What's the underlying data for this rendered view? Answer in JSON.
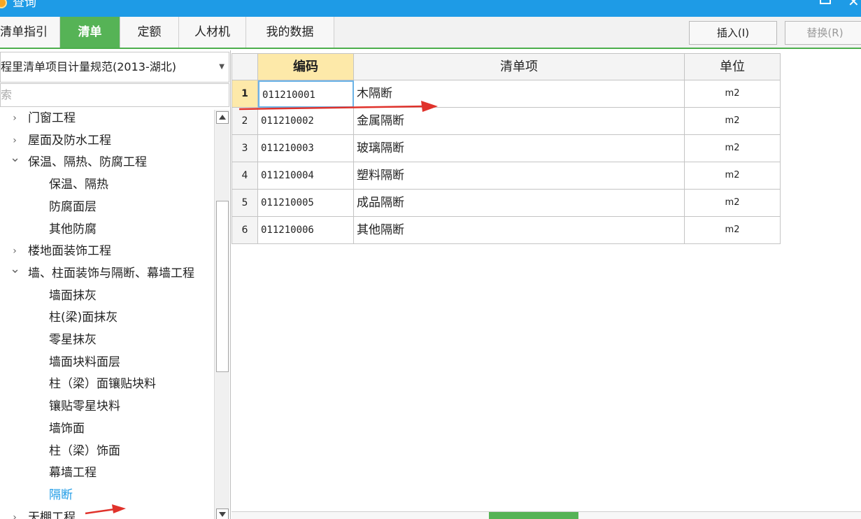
{
  "window": {
    "title": "查询",
    "icons": [
      "app-icon",
      "maximize-icon",
      "close-icon"
    ]
  },
  "tabs": [
    {
      "label": "清单指引",
      "active": false
    },
    {
      "label": "清单",
      "active": true
    },
    {
      "label": "定额",
      "active": false
    },
    {
      "label": "人材机",
      "active": false
    },
    {
      "label": "我的数据",
      "active": false
    }
  ],
  "toolbar": {
    "insert_label": "插入(I)",
    "replace_label": "替换(R)"
  },
  "left": {
    "spec_selected": "程里清单项目计量规范(2013-湖北)",
    "search_placeholder": "索",
    "tree": [
      {
        "label": "门窗工程",
        "level": 0,
        "expanded": false
      },
      {
        "label": "屋面及防水工程",
        "level": 0,
        "expanded": false
      },
      {
        "label": "保温、隔热、防腐工程",
        "level": 0,
        "expanded": true
      },
      {
        "label": "保温、隔热",
        "level": 1
      },
      {
        "label": "防腐面层",
        "level": 1
      },
      {
        "label": "其他防腐",
        "level": 1
      },
      {
        "label": "楼地面装饰工程",
        "level": 0,
        "expanded": false
      },
      {
        "label": "墙、柱面装饰与隔断、幕墙工程",
        "level": 0,
        "expanded": true
      },
      {
        "label": "墙面抹灰",
        "level": 1
      },
      {
        "label": "柱(梁)面抹灰",
        "level": 1
      },
      {
        "label": "零星抹灰",
        "level": 1
      },
      {
        "label": "墙面块料面层",
        "level": 1
      },
      {
        "label": "柱（梁）面镶贴块料",
        "level": 1
      },
      {
        "label": "镶贴零星块料",
        "level": 1
      },
      {
        "label": "墙饰面",
        "level": 1
      },
      {
        "label": "柱（梁）饰面",
        "level": 1
      },
      {
        "label": "幕墙工程",
        "level": 1
      },
      {
        "label": "隔断",
        "level": 1,
        "selected": true
      },
      {
        "label": "天棚工程",
        "level": 0,
        "expanded": false
      }
    ]
  },
  "grid": {
    "headers": {
      "code": "编码",
      "name": "清单项",
      "unit": "单位"
    },
    "rows": [
      {
        "num": "1",
        "code": "011210001",
        "name": "木隔断",
        "unit": "m2"
      },
      {
        "num": "2",
        "code": "011210002",
        "name": "金属隔断",
        "unit": "m2"
      },
      {
        "num": "3",
        "code": "011210003",
        "name": "玻璃隔断",
        "unit": "m2"
      },
      {
        "num": "4",
        "code": "011210004",
        "name": "塑料隔断",
        "unit": "m2"
      },
      {
        "num": "5",
        "code": "011210005",
        "name": "成品隔断",
        "unit": "m2"
      },
      {
        "num": "6",
        "code": "011210006",
        "name": "其他隔断",
        "unit": "m2"
      }
    ]
  },
  "colors": {
    "titlebar": "#1e9be6",
    "tab_active": "#56b356",
    "header_highlight": "#fde9a9",
    "annotation_arrow": "#e0322b",
    "selected_tree_text": "#1e9be6"
  }
}
